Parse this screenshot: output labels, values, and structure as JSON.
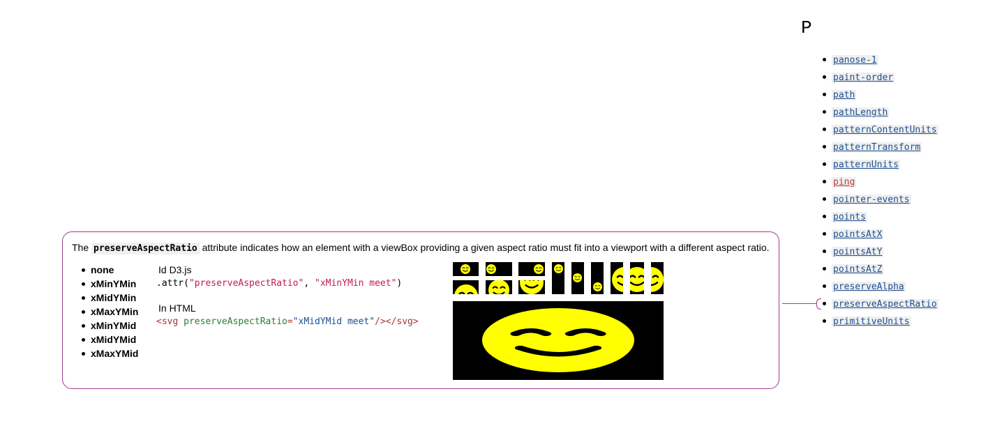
{
  "index": {
    "letter": "P",
    "items": [
      {
        "label": "panose-1",
        "missing": false
      },
      {
        "label": "paint-order",
        "missing": false
      },
      {
        "label": "path",
        "missing": false
      },
      {
        "label": "pathLength",
        "missing": false
      },
      {
        "label": "patternContentUnits",
        "missing": false
      },
      {
        "label": "patternTransform",
        "missing": false
      },
      {
        "label": "patternUnits",
        "missing": false
      },
      {
        "label": "ping",
        "missing": true
      },
      {
        "label": "pointer-events",
        "missing": false
      },
      {
        "label": "points",
        "missing": false
      },
      {
        "label": "pointsAtX",
        "missing": false
      },
      {
        "label": "pointsAtY",
        "missing": false
      },
      {
        "label": "pointsAtZ",
        "missing": false
      },
      {
        "label": "preserveAlpha",
        "missing": false
      },
      {
        "label": "preserveAspectRatio",
        "missing": false
      },
      {
        "label": "primitiveUnits",
        "missing": false
      }
    ]
  },
  "card": {
    "desc_before": "The ",
    "desc_code": "preserveAspectRatio",
    "desc_after": " attribute indicates how an element with a viewBox providing a given aspect ratio must fit into a viewport with a different aspect ratio.",
    "values": [
      "none",
      "xMinYMin",
      "xMidYMin",
      "xMaxYMin",
      "xMinYMid",
      "xMidYMid",
      "xMaxYMid"
    ],
    "d3_title": "Id D3.js",
    "d3_prefix": ".attr(",
    "d3_arg1": "\"preserveAspectRatio\"",
    "d3_sep": ", ",
    "d3_arg2": "\"xMinYMin meet\"",
    "d3_suffix": ")",
    "html_title": "In HTML",
    "html_open": "<svg ",
    "html_attr": "preserveAspectRatio",
    "html_eq": "=",
    "html_val": "\"xMidYMid meet\"",
    "html_close": "/></svg>"
  },
  "colors": {
    "accent_border": "#a23a8c",
    "link": "#1d4f91",
    "link_missing": "#c23b3b",
    "smiley_fill": "#ffff00",
    "demo_background": "#000000"
  }
}
